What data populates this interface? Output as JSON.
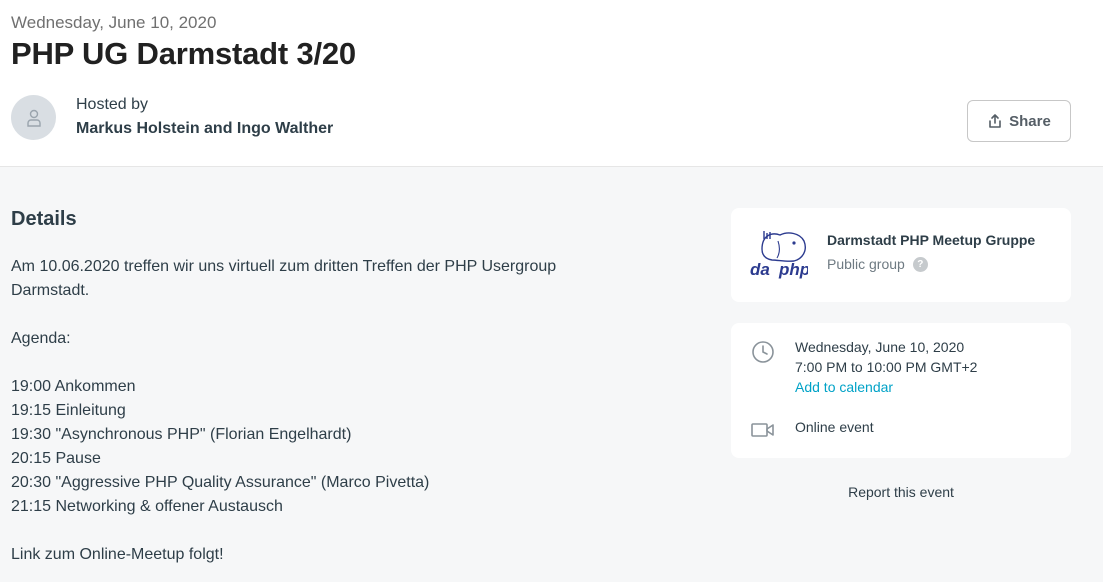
{
  "header": {
    "date": "Wednesday, June 10, 2020",
    "title": "PHP UG Darmstadt 3/20",
    "hosted_by_label": "Hosted by",
    "hosts": "Markus Holstein and Ingo Walther",
    "share_label": "Share"
  },
  "details": {
    "heading": "Details",
    "lines": [
      "Am 10.06.2020 treffen wir uns virtuell zum dritten Treffen der PHP Usergroup Darmstadt.",
      "",
      "Agenda:",
      "",
      "19:00 Ankommen",
      "19:15 Einleitung",
      "19:30 \"Asynchronous PHP\" (Florian Engelhardt)",
      "20:15 Pause",
      "20:30 \"Aggressive PHP Quality Assurance\" (Marco Pivetta)",
      "21:15 Networking & offener Austausch",
      "",
      "Link zum Online-Meetup folgt!"
    ]
  },
  "group": {
    "name": "Darmstadt PHP Meetup Gruppe",
    "type": "Public group",
    "help_glyph": "?",
    "logo_text_left": "da",
    "logo_text_right": "php"
  },
  "event": {
    "date": "Wednesday, June 10, 2020",
    "time": "7:00 PM to 10:00 PM GMT+2",
    "add_to_calendar": "Add to calendar",
    "location_type": "Online event"
  },
  "report_label": "Report this event",
  "icons": {
    "avatar": "user-icon",
    "share": "share-icon",
    "clock": "clock-icon",
    "video": "video-camera-icon",
    "help": "help-icon"
  },
  "colors": {
    "link": "#00a2c7",
    "text": "#2e3e48",
    "muted": "#707070",
    "background": "#f6f7f8",
    "logo": "#2c3b8f"
  }
}
